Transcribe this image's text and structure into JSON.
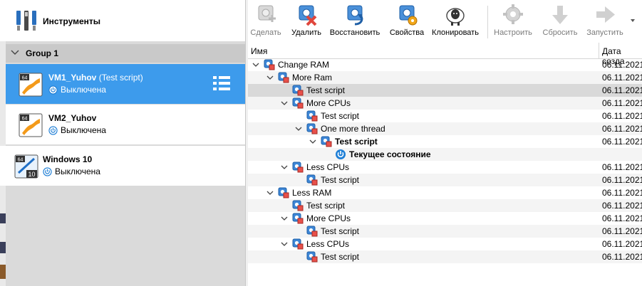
{
  "tools": {
    "label": "Инструменты"
  },
  "group": {
    "label": "Group 1"
  },
  "vms": [
    {
      "name": "VM1_Yuhov",
      "snapshot": "(Test script)",
      "state": "Выключена",
      "badge": "64"
    },
    {
      "name": "VM2_Yuhov",
      "snapshot": "",
      "state": "Выключена",
      "badge": "64"
    },
    {
      "name": "Windows 10",
      "snapshot": "",
      "state": "Выключена",
      "badge": "64",
      "badge2": "10"
    }
  ],
  "toolbar": {
    "take": "Сделать",
    "delete": "Удалить",
    "restore": "Восстановить",
    "properties": "Свойства",
    "clone": "Клонировать",
    "settings": "Настроить",
    "discard": "Сбросить",
    "start": "Запустить"
  },
  "table": {
    "col_name": "Имя",
    "col_date": "Дата созда",
    "rows": [
      {
        "name": "Change RAM",
        "date": "06.11.2021",
        "level": 0,
        "expanded": true
      },
      {
        "name": "More Ram",
        "date": "06.11.2021",
        "level": 1,
        "expanded": true
      },
      {
        "name": "Test script",
        "date": "06.11.2021",
        "level": 2,
        "expanded": null,
        "highlight": true
      },
      {
        "name": "More CPUs",
        "date": "06.11.2021",
        "level": 2,
        "expanded": true
      },
      {
        "name": "Test script",
        "date": "06.11.2021",
        "level": 3,
        "expanded": null
      },
      {
        "name": "One more thread",
        "date": "06.11.2021",
        "level": 3,
        "expanded": true
      },
      {
        "name": "Test script",
        "date": "06.11.2021",
        "level": 4,
        "expanded": true,
        "bold": true
      },
      {
        "name": "Текущее состояние",
        "date": "",
        "level": 5,
        "current": true,
        "bold": true
      },
      {
        "name": "Less CPUs",
        "date": "06.11.2021",
        "level": 2,
        "expanded": true
      },
      {
        "name": "Test script",
        "date": "06.11.2021",
        "level": 3,
        "expanded": null
      },
      {
        "name": "Less RAM",
        "date": "06.11.2021",
        "level": 1,
        "expanded": true
      },
      {
        "name": "Test script",
        "date": "06.11.2021",
        "level": 2,
        "expanded": null
      },
      {
        "name": "More CPUs",
        "date": "06.11.2021",
        "level": 2,
        "expanded": true
      },
      {
        "name": "Test script",
        "date": "06.11.2021",
        "level": 3,
        "expanded": null
      },
      {
        "name": "Less CPUs",
        "date": "06.11.2021",
        "level": 2,
        "expanded": true
      },
      {
        "name": "Test script",
        "date": "06.11.2021",
        "level": 3,
        "expanded": null
      }
    ]
  },
  "colors": {
    "selection": "#3d9bec",
    "accent_blue": "#1f7fd6",
    "delete_red": "#e0463c"
  }
}
